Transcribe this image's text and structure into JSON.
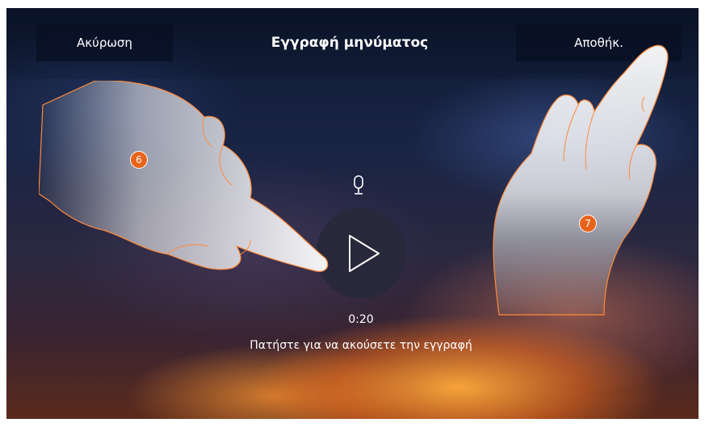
{
  "header": {
    "cancel_label": "Ακύρωση",
    "title": "Εγγραφή μηνύματος",
    "save_label": "Αποθήκ."
  },
  "recording": {
    "mic_icon": "microphone-icon",
    "play_icon": "play-icon",
    "time": "0:20",
    "hint": "Πατήστε για να ακούσετε την εγγραφή"
  },
  "callouts": [
    {
      "number": "6"
    },
    {
      "number": "7"
    }
  ],
  "colors": {
    "accent": "#e8641c",
    "panel": "#0a1222",
    "text": "#ffffff"
  }
}
